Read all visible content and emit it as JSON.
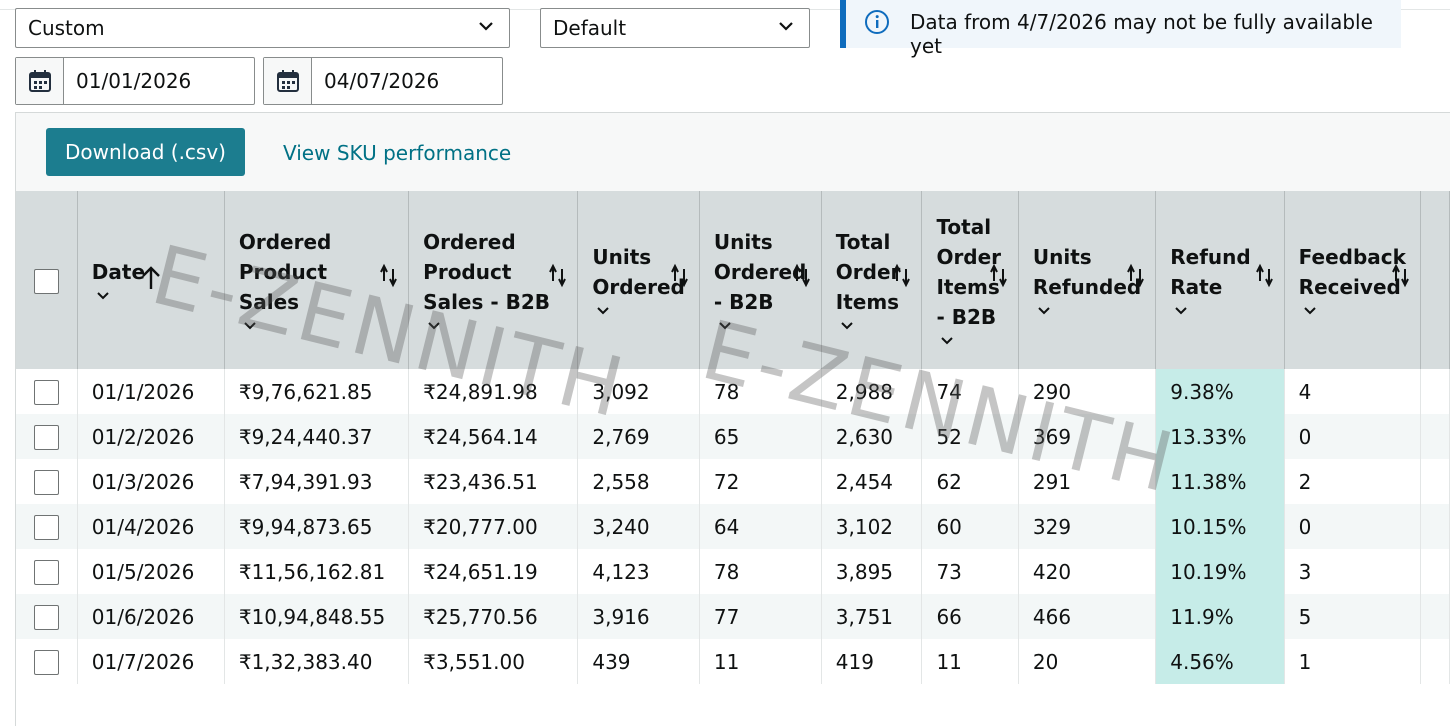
{
  "filters": {
    "range_select": "Custom",
    "view_select": "Default",
    "start_date": "01/01/2026",
    "end_date": "04/07/2026"
  },
  "notice": {
    "text": "Data from 4/7/2026 may not be fully available yet",
    "icon": "info-icon"
  },
  "toolbar": {
    "download_label": "Download (.csv)",
    "sku_link": "View SKU performance"
  },
  "watermark": "E-ZENNITH",
  "table": {
    "columns": [
      {
        "lines": [
          "Date"
        ],
        "sort": "ascending"
      },
      {
        "lines": [
          "Ordered",
          "Product Sales"
        ],
        "sort": "none"
      },
      {
        "lines": [
          "Ordered",
          "Product",
          "Sales - B2B"
        ],
        "sort": "none"
      },
      {
        "lines": [
          "Units",
          "Ordered"
        ],
        "sort": "none"
      },
      {
        "lines": [
          "Units",
          "Ordered",
          "- B2B"
        ],
        "sort": "none"
      },
      {
        "lines": [
          "Total",
          "Order",
          "Items"
        ],
        "sort": "none"
      },
      {
        "lines": [
          "Total",
          "Order",
          "Items",
          "- B2B"
        ],
        "sort": "none"
      },
      {
        "lines": [
          "Units",
          "Refunded"
        ],
        "sort": "none"
      },
      {
        "lines": [
          "Refund",
          "Rate"
        ],
        "sort": "none"
      },
      {
        "lines": [
          "Feedback",
          "Received"
        ],
        "sort": "none"
      }
    ],
    "rows": [
      [
        "01/1/2026",
        "₹9,76,621.85",
        "₹24,891.98",
        "3,092",
        "78",
        "2,988",
        "74",
        "290",
        "9.38%",
        "4"
      ],
      [
        "01/2/2026",
        "₹9,24,440.37",
        "₹24,564.14",
        "2,769",
        "65",
        "2,630",
        "52",
        "369",
        "13.33%",
        "0"
      ],
      [
        "01/3/2026",
        "₹7,94,391.93",
        "₹23,436.51",
        "2,558",
        "72",
        "2,454",
        "62",
        "291",
        "11.38%",
        "2"
      ],
      [
        "01/4/2026",
        "₹9,94,873.65",
        "₹20,777.00",
        "3,240",
        "64",
        "3,102",
        "60",
        "329",
        "10.15%",
        "0"
      ],
      [
        "01/5/2026",
        "₹11,56,162.81",
        "₹24,651.19",
        "4,123",
        "78",
        "3,895",
        "73",
        "420",
        "10.19%",
        "3"
      ],
      [
        "01/6/2026",
        "₹10,94,848.55",
        "₹25,770.56",
        "3,916",
        "77",
        "3,751",
        "66",
        "466",
        "11.9%",
        "5"
      ],
      [
        "01/7/2026",
        "₹1,32,383.40",
        "₹3,551.00",
        "439",
        "11",
        "419",
        "11",
        "20",
        "4.56%",
        "1"
      ]
    ]
  },
  "colors": {
    "button": "#1c7d8f",
    "link": "#007185",
    "header_bg": "#d6dcdd",
    "refund_highlight": "#c6ece8",
    "info_accent": "#0f6cbd"
  }
}
